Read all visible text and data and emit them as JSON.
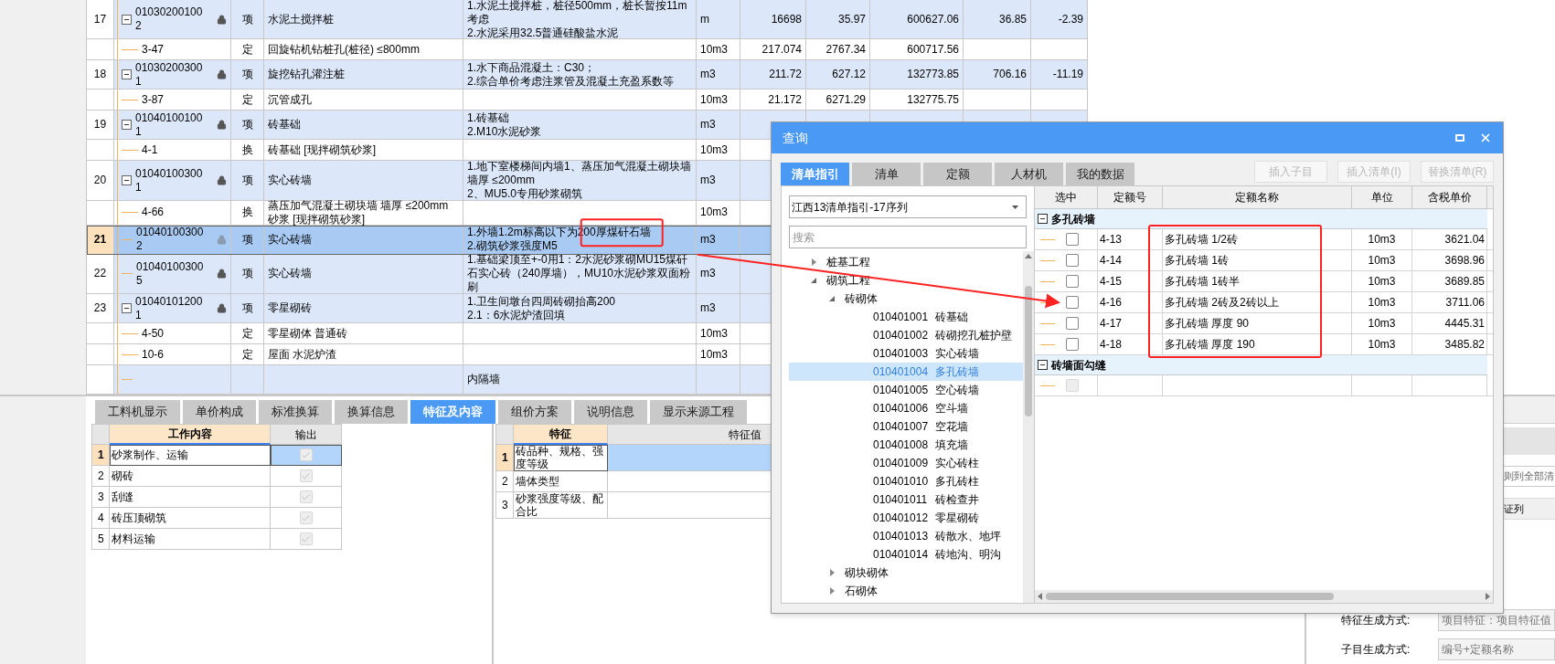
{
  "main_table": {
    "rows": [
      {
        "kind": "item",
        "number": "17",
        "code": "010302001002",
        "locked": true,
        "expanded": true,
        "type": "项",
        "name": "水泥土搅拌桩",
        "features": [
          "1.水泥土搅拌桩，桩径500mm，桩长暂按11m考虑",
          "2.水泥采用32.5普通硅酸盐水泥"
        ],
        "unit": "m",
        "quantity": "16698",
        "price": "35.97",
        "total": "600627.06",
        "column_10": "36.85",
        "column_11": "-2.39",
        "selected": false
      },
      {
        "kind": "sub",
        "code": "3-47",
        "type": "定",
        "name": "回旋钻机钻桩孔(桩径) ≤800mm",
        "unit": "10m3",
        "quantity": "217.074",
        "price": "2767.34",
        "total": "600717.56",
        "selected": false
      },
      {
        "kind": "item",
        "number": "18",
        "code": "010302003001",
        "locked": true,
        "expanded": true,
        "type": "项",
        "name": "旋挖钻孔灌注桩",
        "features": [
          "1.水下商品混凝土：C30；",
          "2.综合单价考虑注浆管及混凝土充盈系数等"
        ],
        "unit": "m3",
        "quantity": "211.72",
        "price": "627.12",
        "total": "132773.85",
        "column_10": "706.16",
        "column_11": "-11.19",
        "selected": false
      },
      {
        "kind": "sub",
        "code": "3-87",
        "type": "定",
        "name": "沉管成孔",
        "unit": "10m3",
        "quantity": "21.172",
        "price": "6271.29",
        "total": "132775.75",
        "selected": false
      },
      {
        "kind": "item",
        "number": "19",
        "code": "010401001001",
        "locked": true,
        "expanded": true,
        "type": "项",
        "name": "砖基础",
        "features": [
          "1.砖基础",
          "2.M10水泥砂浆"
        ],
        "unit": "m3",
        "selected": false
      },
      {
        "kind": "sub",
        "code": "4-1",
        "type": "换",
        "name": "砖基础 [现拌砌筑砂浆]",
        "unit": "10m3",
        "selected": false
      },
      {
        "kind": "item",
        "number": "20",
        "code": "010401003001",
        "locked": true,
        "expanded": true,
        "type": "项",
        "name": "实心砖墙",
        "features": [
          "1.地下室楼梯间内墙1、蒸压加气混凝土砌块墙墙厚 ≤200mm",
          "2、MU5.0专用砂浆砌筑"
        ],
        "unit": "m3",
        "selected": false
      },
      {
        "kind": "sub",
        "code": "4-66",
        "type": "换",
        "name": "蒸压加气混凝土砌块墙 墙厚 ≤200mm 砂浆 [现拌砌筑砂浆]",
        "unit": "10m3",
        "selected": false
      },
      {
        "kind": "item",
        "number": "21",
        "code": "010401003002",
        "locked": true,
        "expanded": false,
        "type": "项",
        "name": "实心砖墙",
        "features": [
          "1.外墙1.2m标高以下为200厚煤矸石墙",
          "2.砌筑砂浆强度M5"
        ],
        "unit": "m3",
        "selected": true
      },
      {
        "kind": "item",
        "number": "22",
        "code": "010401003005",
        "locked": true,
        "expanded": false,
        "type": "项",
        "name": "实心砖墙",
        "features": [
          "1.基础梁顶至+-0用1：2水泥砂浆砌MU15煤矸石实心砖（240厚墙），MU10水泥砂浆双面粉刷"
        ],
        "unit": "m3",
        "selected": false
      },
      {
        "kind": "item",
        "number": "23",
        "code": "010401012001",
        "locked": true,
        "expanded": true,
        "type": "项",
        "name": "零星砌砖",
        "features": [
          "1.卫生间墩台四周砖砌抬高200",
          "2.1：6水泥炉渣回填"
        ],
        "unit": "m3",
        "selected": false
      },
      {
        "kind": "sub",
        "code": "4-50",
        "type": "定",
        "name": "零星砌体 普通砖",
        "unit": "10m3",
        "selected": false
      },
      {
        "kind": "sub",
        "code": "10-6",
        "type": "定",
        "name": "屋面 水泥炉渣",
        "unit": "10m3",
        "selected": false
      },
      {
        "kind": "item",
        "features": [
          "内隔墙"
        ],
        "selected": false
      }
    ]
  },
  "bottom_tabs": [
    {
      "label": "工料机显示",
      "selected": false
    },
    {
      "label": "单价构成",
      "selected": false
    },
    {
      "label": "标准换算",
      "selected": false
    },
    {
      "label": "换算信息",
      "selected": false
    },
    {
      "label": "特征及内容",
      "selected": true
    },
    {
      "label": "组价方案",
      "selected": false
    },
    {
      "label": "说明信息",
      "selected": false
    },
    {
      "label": "显示来源工程",
      "selected": false
    }
  ],
  "work_content": {
    "columns": [
      "工作内容",
      "输出"
    ],
    "rows": [
      {
        "number": "1",
        "text": "砂浆制作、运输",
        "checked": true,
        "selected": true
      },
      {
        "number": "2",
        "text": "砌砖",
        "checked": true,
        "selected": false
      },
      {
        "number": "3",
        "text": "刮缝",
        "checked": true,
        "selected": false
      },
      {
        "number": "4",
        "text": "砖压顶砌筑",
        "checked": true,
        "selected": false
      },
      {
        "number": "5",
        "text": "材料运输",
        "checked": true,
        "selected": false
      }
    ]
  },
  "features_grid": {
    "columns": [
      "特征",
      "特征值"
    ],
    "rows": [
      {
        "number": "1",
        "feature": "砖品种、规格、强度等级",
        "selected": true
      },
      {
        "number": "2",
        "feature": "墙体类型",
        "selected": false
      },
      {
        "number": "3",
        "feature": "砂浆强度等级、配合比",
        "selected": false
      }
    ]
  },
  "side_panel": {
    "cut_field": "则到全部清",
    "cut_header": "证列",
    "settings": [
      {
        "label": "特征生成方式:",
        "value": "项目特征：项目特征值"
      },
      {
        "label": "子目生成方式:",
        "value": "编号+定额名称"
      }
    ]
  },
  "dialog": {
    "title": "查询",
    "tabs": [
      {
        "label": "清单指引",
        "selected": true
      },
      {
        "label": "清单",
        "selected": false
      },
      {
        "label": "定额",
        "selected": false
      },
      {
        "label": "人材机",
        "selected": false
      },
      {
        "label": "我的数据",
        "selected": false
      }
    ],
    "buttons": [
      {
        "label": "插入子目",
        "disabled": true
      },
      {
        "label": "插入清单(I)",
        "disabled": true
      },
      {
        "label": "替换清单(R)",
        "disabled": true
      }
    ],
    "library": "江西13清单指引-17序列",
    "search": {
      "placeholder": "搜索"
    },
    "tree": [
      {
        "label": "桩基工程",
        "expanded": false,
        "selected": false
      },
      {
        "label": "砌筑工程",
        "expanded": true,
        "selected": false,
        "children": [
          {
            "label": "砖砌体",
            "expanded": true,
            "selected": false,
            "children": [
              {
                "code": "010401001",
                "label": "砖基础",
                "selected": false
              },
              {
                "code": "010401002",
                "label": "砖砌挖孔桩护壁",
                "selected": false
              },
              {
                "code": "010401003",
                "label": "实心砖墙",
                "selected": false
              },
              {
                "code": "010401004",
                "label": "多孔砖墙",
                "selected": true
              },
              {
                "code": "010401005",
                "label": "空心砖墙",
                "selected": false
              },
              {
                "code": "010401006",
                "label": "空斗墙",
                "selected": false
              },
              {
                "code": "010401007",
                "label": "空花墙",
                "selected": false
              },
              {
                "code": "010401008",
                "label": "填充墙",
                "selected": false
              },
              {
                "code": "010401009",
                "label": "实心砖柱",
                "selected": false
              },
              {
                "code": "010401010",
                "label": "多孔砖柱",
                "selected": false
              },
              {
                "code": "010401011",
                "label": "砖检查井",
                "selected": false
              },
              {
                "code": "010401012",
                "label": "零星砌砖",
                "selected": false
              },
              {
                "code": "010401013",
                "label": "砖散水、地坪",
                "selected": false
              },
              {
                "code": "010401014",
                "label": "砖地沟、明沟",
                "selected": false
              }
            ]
          },
          {
            "label": "砌块砌体",
            "expanded": false,
            "selected": false
          },
          {
            "label": "石砌体",
            "expanded": false,
            "selected": false
          }
        ]
      }
    ],
    "grid": {
      "columns": [
        "选中",
        "定额号",
        "定额名称",
        "单位",
        "含税单价"
      ],
      "groups": [
        {
          "name": "多孔砖墙",
          "expanded": true,
          "rows": [
            {
              "code": "4-13",
              "name": "多孔砖墙 1/2砖",
              "unit": "10m3",
              "price": "3621.04",
              "checked": false,
              "disabled": false
            },
            {
              "code": "4-14",
              "name": "多孔砖墙 1砖",
              "unit": "10m3",
              "price": "3698.96",
              "checked": false,
              "disabled": false
            },
            {
              "code": "4-15",
              "name": "多孔砖墙 1砖半",
              "unit": "10m3",
              "price": "3689.85",
              "checked": false,
              "disabled": false
            },
            {
              "code": "4-16",
              "name": "多孔砖墙 2砖及2砖以上",
              "unit": "10m3",
              "price": "3711.06",
              "checked": false,
              "disabled": false
            },
            {
              "code": "4-17",
              "name": "多孔砖墙 厚度 90",
              "unit": "10m3",
              "price": "4445.31",
              "checked": false,
              "disabled": false
            },
            {
              "code": "4-18",
              "name": "多孔砖墙 厚度 190",
              "unit": "10m3",
              "price": "3485.82",
              "checked": false,
              "disabled": false
            }
          ]
        },
        {
          "name": "砖墙面勾缝",
          "expanded": true,
          "rows": [
            {
              "checked": false,
              "disabled": true
            }
          ]
        }
      ]
    }
  }
}
